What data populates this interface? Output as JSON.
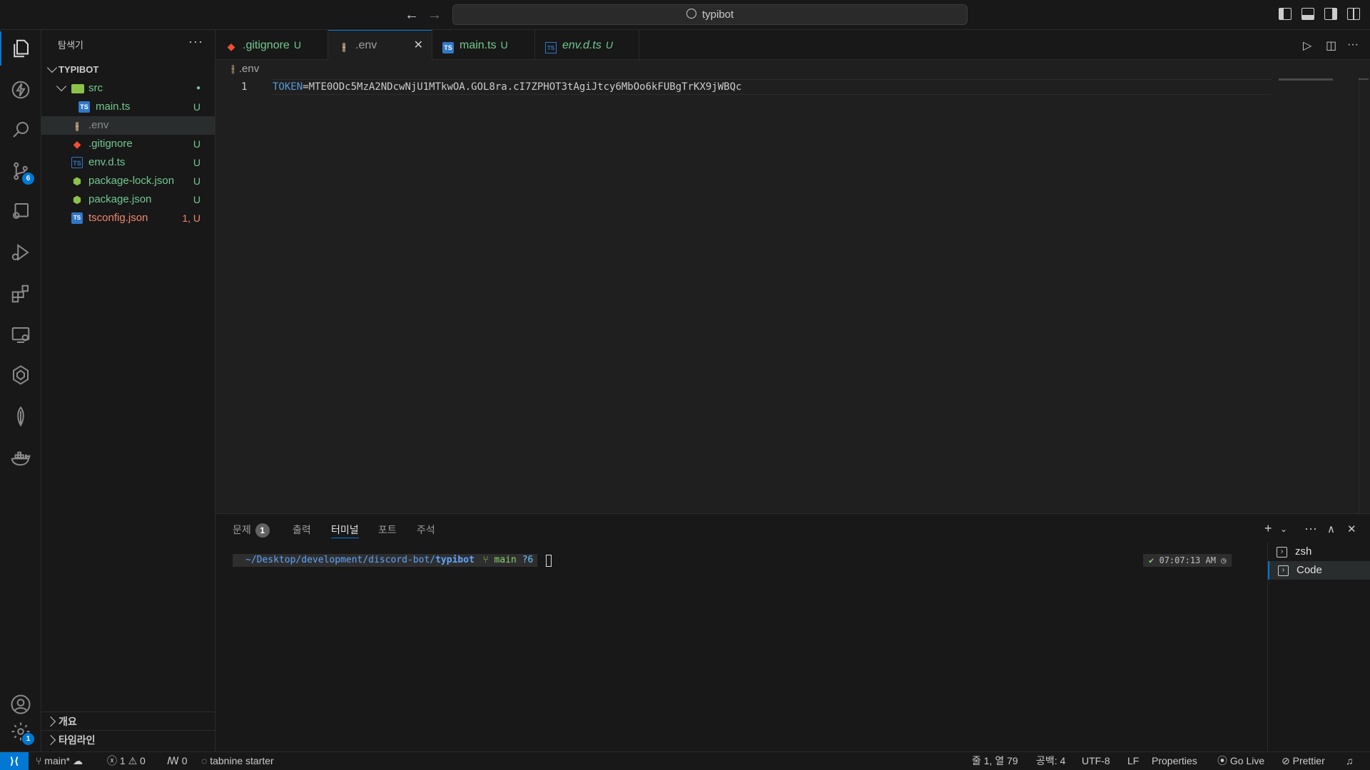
{
  "titlebar": {
    "search_text": "typibot",
    "back_icon": "←",
    "forward_icon": "→"
  },
  "activity": {
    "source_control_badge": "6",
    "settings_badge": "1"
  },
  "sidebar": {
    "title": "탐색기",
    "more": "···",
    "project": "TYPIBOT",
    "files": [
      {
        "name": "src",
        "status": "●"
      },
      {
        "name": "main.ts",
        "status": "U",
        "icon": "TS"
      },
      {
        "name": ".env",
        "status": "",
        "icon": "⫲"
      },
      {
        "name": ".gitignore",
        "status": "U",
        "icon": "◆"
      },
      {
        "name": "env.d.ts",
        "status": "U",
        "icon": "TS"
      },
      {
        "name": "package-lock.json",
        "status": "U",
        "icon": "⬢"
      },
      {
        "name": "package.json",
        "status": "U",
        "icon": "⬢"
      },
      {
        "name": "tsconfig.json",
        "status": "1, U",
        "icon": "TS"
      }
    ],
    "sections": [
      "개요",
      "타임라인"
    ]
  },
  "tabs": [
    {
      "label": ".gitignore",
      "status": "U",
      "icon": "◆"
    },
    {
      "label": ".env",
      "close": "✕",
      "icon": "⫲"
    },
    {
      "label": "main.ts",
      "status": "U",
      "icon": "TS"
    },
    {
      "label": "env.d.ts",
      "status": "U",
      "icon": "TS"
    }
  ],
  "editor": {
    "breadcrumb": ".env",
    "breadcrumb_icon": "⫲",
    "line_number": "1",
    "code_key": "TOKEN",
    "code_value": "=MTE0ODc5MzA2NDcwNjU1MTkwOA.GOL8ra.cI7ZPHOT3tAgiJtcy6MbOo6kFUBgTrKX9jWBQc"
  },
  "panel": {
    "tabs": [
      "문제",
      "출력",
      "터미널",
      "포트",
      "주석"
    ],
    "problems_count": "1",
    "prompt_path_prefix": "~/Desktop/development/discord-bot/",
    "prompt_path_current": "typibot",
    "prompt_branch": "main",
    "prompt_changes": "?6",
    "prompt_time": "07:07:13 AM",
    "prompt_ok": "✔",
    "terminals": [
      "zsh",
      "Code"
    ]
  },
  "statusbar": {
    "remote": "⟩⟨",
    "branch": "main*",
    "errors": "1",
    "warnings": "0",
    "ports": "0",
    "tabnine": "tabnine starter",
    "position": "줄 1, 열 79",
    "spaces": "공백: 4",
    "encoding": "UTF-8",
    "eol": "LF",
    "language": "Properties",
    "golive": "Go Live",
    "prettier": "Prettier"
  }
}
